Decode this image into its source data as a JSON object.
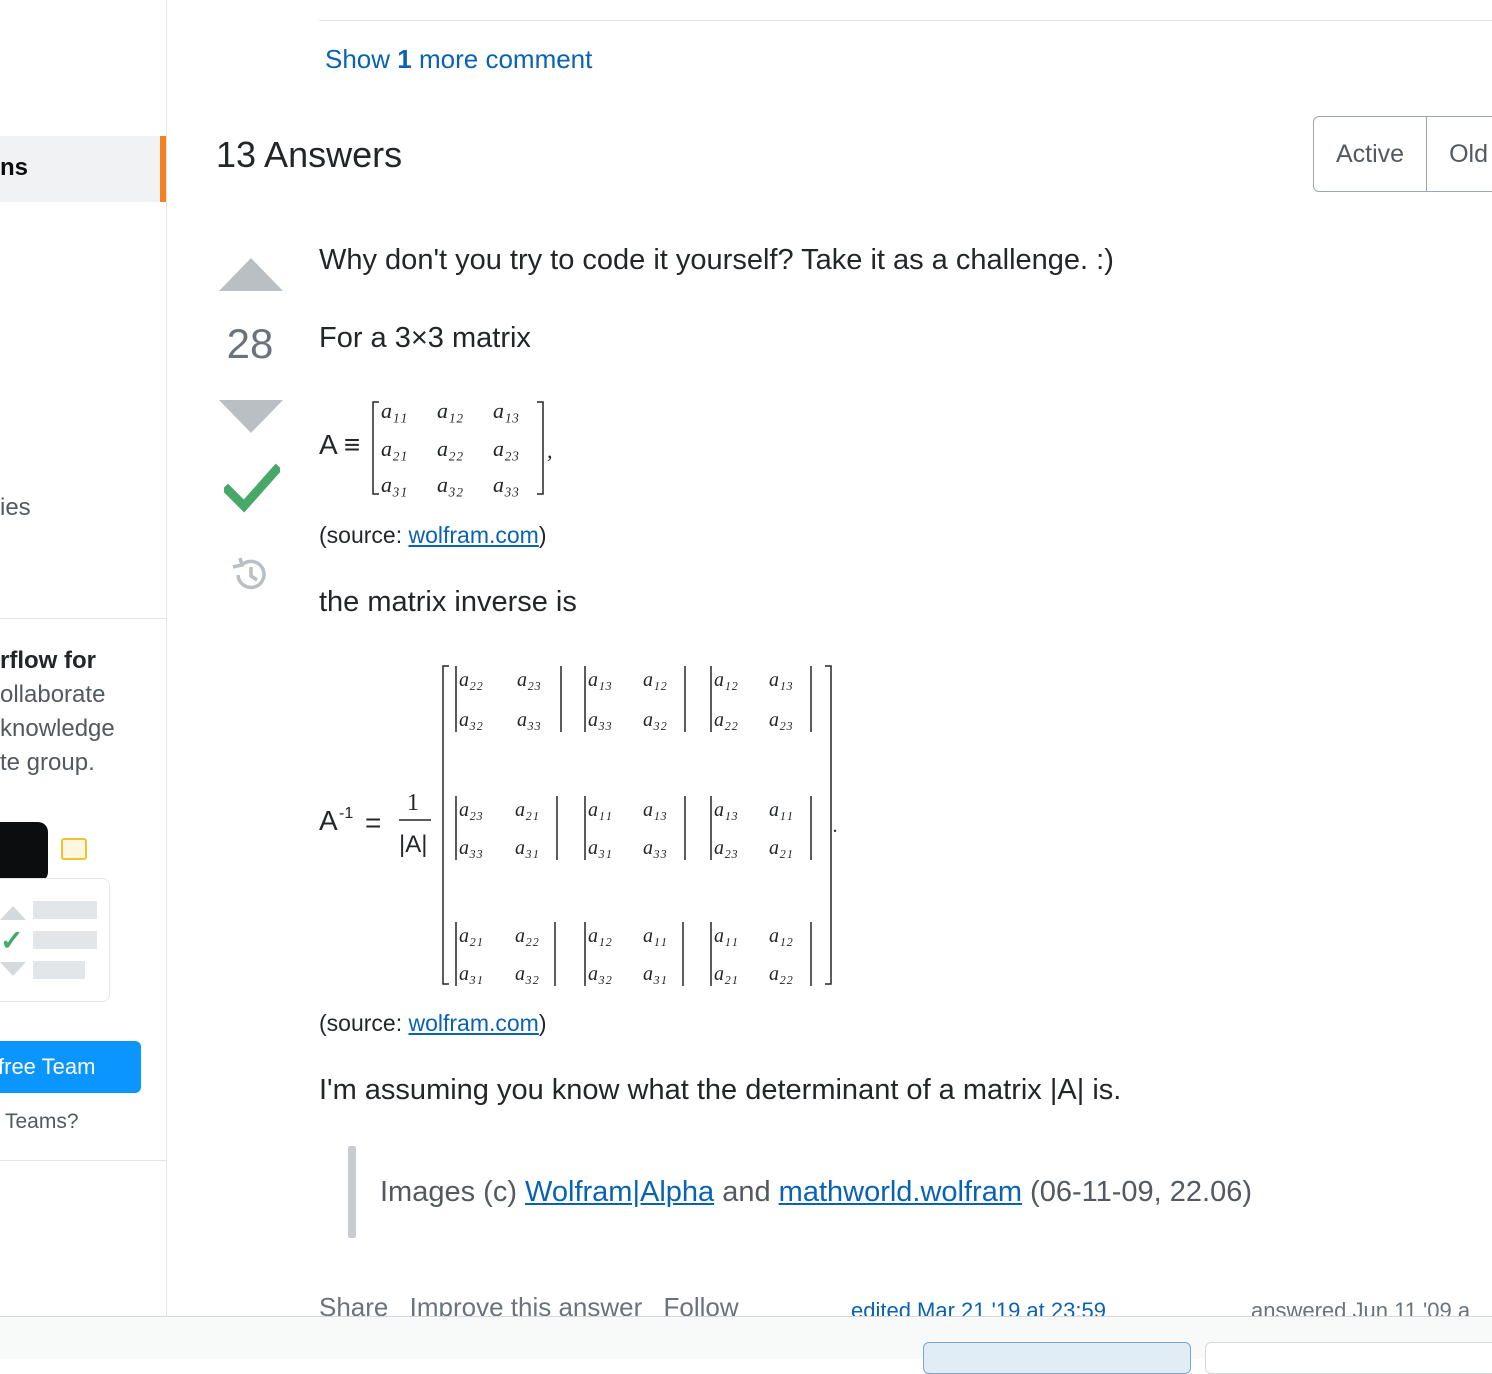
{
  "sidebar": {
    "active_label_fragment": "ns",
    "item_fragment": "ies",
    "teams_title_fragment": "rflow for",
    "teams_lines": [
      "ollaborate",
      "knowledge",
      "te group."
    ],
    "teams_button_fragment": "free Team",
    "teams_question_fragment": "Teams?"
  },
  "comments": {
    "show_more_prefix": "Show",
    "show_more_count": "1",
    "show_more_suffix": "more comment"
  },
  "answers": {
    "heading": "13 Answers",
    "sort_options": [
      "Active",
      "Old"
    ]
  },
  "answer": {
    "vote_count": "28",
    "paragraph1": "Why don't you try to code it yourself? Take it as a challenge. :)",
    "paragraph2": "For a 3×3 matrix",
    "source_label": "(source: ",
    "source_link": "wolfram.com",
    "source_close": ")",
    "paragraph3": "the matrix inverse is",
    "paragraph4": "I'm assuming you know what the determinant of a matrix |A| is.",
    "quote_prefix": "Images (c) ",
    "quote_link1": "Wolfram|Alpha",
    "quote_and": " and ",
    "quote_link2": "mathworld.wolfram",
    "quote_suffix": " (06-11-09, 22.06)",
    "footer_links": [
      "Share",
      "Improve this answer",
      "Follow"
    ],
    "edited": "edited Mar 21 '19 at 23:59",
    "answered": "answered Jun 11 '09 a"
  },
  "colors": {
    "accent_orange": "#f48225",
    "link_blue": "#0a62b5",
    "accept_green": "#48a868",
    "team_button_blue": "#0a95ff"
  },
  "icons": [
    "vote-up-icon",
    "vote-down-icon",
    "accepted-check-icon",
    "history-icon"
  ]
}
